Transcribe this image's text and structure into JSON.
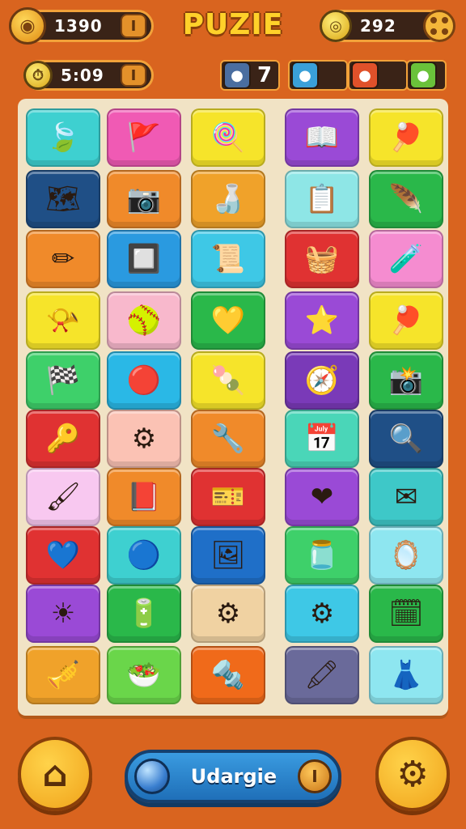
{
  "header": {
    "title": "PUZIE",
    "coins": {
      "value": "1390",
      "icon": "coin-icon",
      "plus": "I"
    },
    "gems": {
      "value": "292",
      "icon": "gold-coin-icon"
    },
    "timer": {
      "value": "5:09",
      "icon": "clock-icon",
      "plus": "I"
    },
    "powerups": [
      {
        "name": "hint",
        "icon": "leaf-icon",
        "count": "7",
        "color": "#4a6ea0"
      },
      {
        "name": "shuffle",
        "icon": "cross-icon",
        "count": "",
        "color": "#3aa0d8"
      },
      {
        "name": "bomb",
        "icon": "star-icon",
        "count": "",
        "color": "#e0512a"
      },
      {
        "name": "swap",
        "icon": "paw-icon",
        "count": "",
        "color": "#6ac23a"
      }
    ]
  },
  "board": {
    "rows": [
      [
        {
          "icon": "leaf-icon",
          "glyph": "🍃",
          "color": "#3ed0d0"
        },
        {
          "icon": "flag-icon",
          "glyph": "🚩",
          "color": "#f05ab4"
        },
        {
          "icon": "lollipop-icon",
          "glyph": "🍭",
          "color": "#f6e42a"
        },
        {
          "icon": "book-open-icon",
          "glyph": "📖",
          "color": "#9a4ad6"
        },
        {
          "icon": "paddle-icon",
          "glyph": "🏓",
          "color": "#f6e42a"
        }
      ],
      [
        {
          "icon": "map-icon",
          "glyph": "🗺",
          "color": "#1f4f86"
        },
        {
          "icon": "camera-icon",
          "glyph": "📷",
          "color": "#f08a2a"
        },
        {
          "icon": "bottle-icon",
          "glyph": "🍶",
          "color": "#f0a22a"
        },
        {
          "icon": "clipboard-icon",
          "glyph": "📋",
          "color": "#8ee6e6"
        },
        {
          "icon": "feather-icon",
          "glyph": "🪶",
          "color": "#2ab84a"
        }
      ],
      [
        {
          "icon": "pencil-icon",
          "glyph": "✏",
          "color": "#f08a2a"
        },
        {
          "icon": "chip-icon",
          "glyph": "🔲",
          "color": "#2a9ae0"
        },
        {
          "icon": "scroll-icon",
          "glyph": "📜",
          "color": "#3ec8e6"
        },
        {
          "icon": "pot-icon",
          "glyph": "🧺",
          "color": "#e03232"
        },
        {
          "icon": "potion-icon",
          "glyph": "🧪",
          "color": "#f58cd0"
        }
      ],
      [
        {
          "icon": "horn-icon",
          "glyph": "📯",
          "color": "#f6e42a"
        },
        {
          "icon": "ball-icon",
          "glyph": "🥎",
          "color": "#f8b8cc"
        },
        {
          "icon": "heart-icon",
          "glyph": "💛",
          "color": "#2ab84a"
        },
        {
          "icon": "star-icon",
          "glyph": "⭐",
          "color": "#9a4ad6"
        },
        {
          "icon": "paddle-icon",
          "glyph": "🏓",
          "color": "#f6e42a"
        }
      ],
      [
        {
          "icon": "flag-icon",
          "glyph": "🏁",
          "color": "#3ed06a"
        },
        {
          "icon": "ball-icon",
          "glyph": "🔴",
          "color": "#2ab8e6"
        },
        {
          "icon": "mace-icon",
          "glyph": "🍡",
          "color": "#f6e42a"
        },
        {
          "icon": "compass-icon",
          "glyph": "🧭",
          "color": "#7a3ab8"
        },
        {
          "icon": "camera-icon",
          "glyph": "📸",
          "color": "#2ab84a"
        }
      ],
      [
        {
          "icon": "key-icon",
          "glyph": "🔑",
          "color": "#e03232"
        },
        {
          "icon": "gear-icon",
          "glyph": "⚙",
          "color": "#fbc2b4"
        },
        {
          "icon": "wrench-icon",
          "glyph": "🔧",
          "color": "#f08a2a"
        },
        {
          "icon": "calendar-icon",
          "glyph": "📅",
          "color": "#4ad6b8"
        },
        {
          "icon": "magnifier-icon",
          "glyph": "🔍",
          "color": "#1f4f86"
        }
      ],
      [
        {
          "icon": "brush-icon",
          "glyph": "🖌",
          "color": "#f8c8f0"
        },
        {
          "icon": "book-icon",
          "glyph": "📕",
          "color": "#f08a2a"
        },
        {
          "icon": "ticket-icon",
          "glyph": "🎫",
          "color": "#e03232"
        },
        {
          "icon": "heart-icon",
          "glyph": "❤",
          "color": "#9a4ad6"
        },
        {
          "icon": "envelope-icon",
          "glyph": "✉",
          "color": "#3ec8c8"
        }
      ],
      [
        {
          "icon": "heart-icon",
          "glyph": "💙",
          "color": "#e03232"
        },
        {
          "icon": "ball-icon",
          "glyph": "🔵",
          "color": "#3ed0d0"
        },
        {
          "icon": "frame-icon",
          "glyph": "🖼",
          "color": "#1f6fc8"
        },
        {
          "icon": "jar-icon",
          "glyph": "🫙",
          "color": "#3ed06a"
        },
        {
          "icon": "mirror-icon",
          "glyph": "🪞",
          "color": "#8ee6f0"
        }
      ],
      [
        {
          "icon": "sun-icon",
          "glyph": "☀",
          "color": "#9a4ad6"
        },
        {
          "icon": "battery-icon",
          "glyph": "🔋",
          "color": "#2ab84a"
        },
        {
          "icon": "gear-icon",
          "glyph": "⚙",
          "color": "#f0d2a2"
        },
        {
          "icon": "gear-icon",
          "glyph": "⚙",
          "color": "#3ec8e6"
        },
        {
          "icon": "calendar-icon",
          "glyph": "🗓",
          "color": "#2ab84a"
        }
      ],
      [
        {
          "icon": "trumpet-icon",
          "glyph": "🎺",
          "color": "#f0a22a"
        },
        {
          "icon": "bowl-icon",
          "glyph": "🥗",
          "color": "#6ad64a"
        },
        {
          "icon": "wrench-icon",
          "glyph": "🔩",
          "color": "#f06a1a"
        },
        {
          "icon": "brush-icon",
          "glyph": "🖍",
          "color": "#6a6a9a"
        },
        {
          "icon": "dress-icon",
          "glyph": "👗",
          "color": "#8ee6f0"
        }
      ]
    ]
  },
  "footer": {
    "home_icon": "home-icon",
    "home_glyph": "⌂",
    "upgrade_label": "Udargie",
    "upgrade_plus": "I",
    "settings_icon": "gear-icon",
    "settings_glyph": "⚙"
  }
}
